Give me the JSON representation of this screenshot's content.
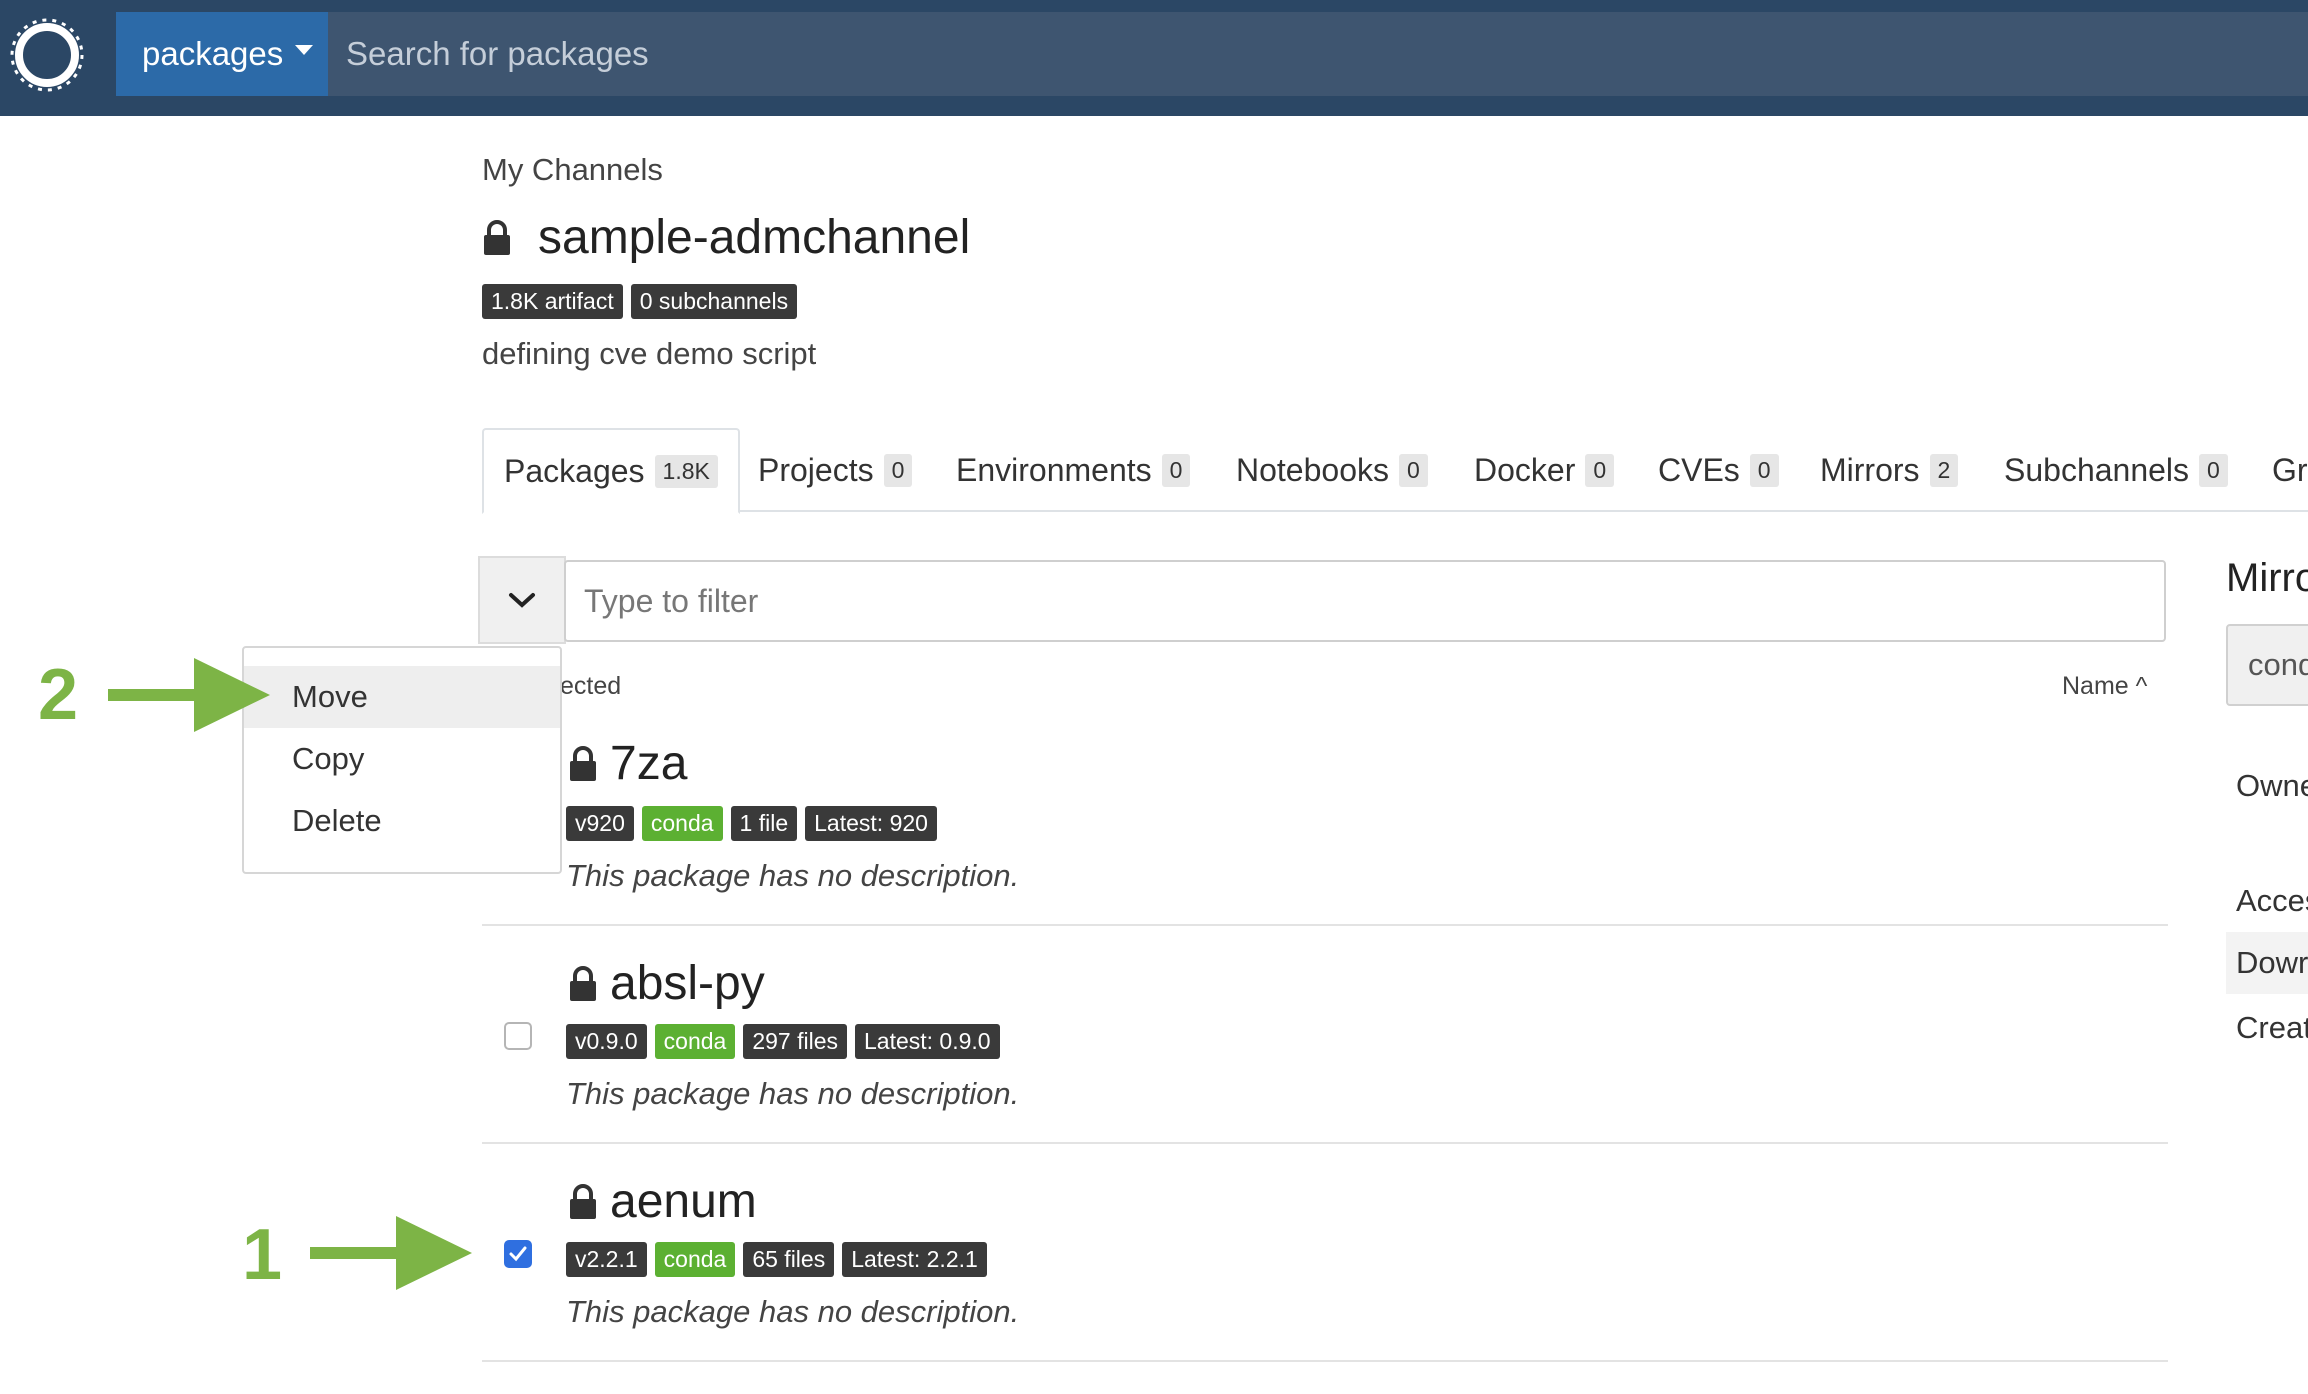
{
  "navbar": {
    "dropdown_label": "packages",
    "search_placeholder": "Search for packages"
  },
  "header": {
    "breadcrumb": "My Channels",
    "channel_name": "sample-admchannel",
    "badges": [
      "1.8K artifact",
      "0 subchannels"
    ],
    "description": "defining cve demo script"
  },
  "tabs": [
    {
      "label": "Packages",
      "count": "1.8K"
    },
    {
      "label": "Projects",
      "count": "0"
    },
    {
      "label": "Environments",
      "count": "0"
    },
    {
      "label": "Notebooks",
      "count": "0"
    },
    {
      "label": "Docker",
      "count": "0"
    },
    {
      "label": "CVEs",
      "count": "0"
    },
    {
      "label": "Mirrors",
      "count": "2"
    },
    {
      "label": "Subchannels",
      "count": "0"
    },
    {
      "label": "Gr",
      "count": ""
    }
  ],
  "filter": {
    "placeholder": "Type to filter",
    "selected_text": "ected",
    "sort_label": "Name ^"
  },
  "menu": {
    "items": [
      "Move",
      "Copy",
      "Delete"
    ]
  },
  "packages": [
    {
      "name": "7za",
      "version": "v920",
      "type": "conda",
      "files": "1 file",
      "latest": "Latest: 920",
      "description": "This package has no description.",
      "checked": null
    },
    {
      "name": "absl-py",
      "version": "v0.9.0",
      "type": "conda",
      "files": "297 files",
      "latest": "Latest: 0.9.0",
      "description": "This package has no description.",
      "checked": false
    },
    {
      "name": "aenum",
      "version": "v2.2.1",
      "type": "conda",
      "files": "65 files",
      "latest": "Latest: 2.2.1",
      "description": "This package has no description.",
      "checked": true
    }
  ],
  "annotations": {
    "step1": "1",
    "step2": "2",
    "arrow_color": "#7db446"
  },
  "right_panel": {
    "title": "Mirro",
    "select_value": "cond",
    "rows": [
      "Owne",
      "Acces",
      "Dowr",
      "Creat"
    ]
  },
  "colors": {
    "navbar": "#2b4765",
    "dropdown": "#2c6aa8",
    "conda_badge": "#5cb032",
    "dark_badge": "#3a3a3a",
    "checkbox_checked": "#2f6fe0"
  }
}
